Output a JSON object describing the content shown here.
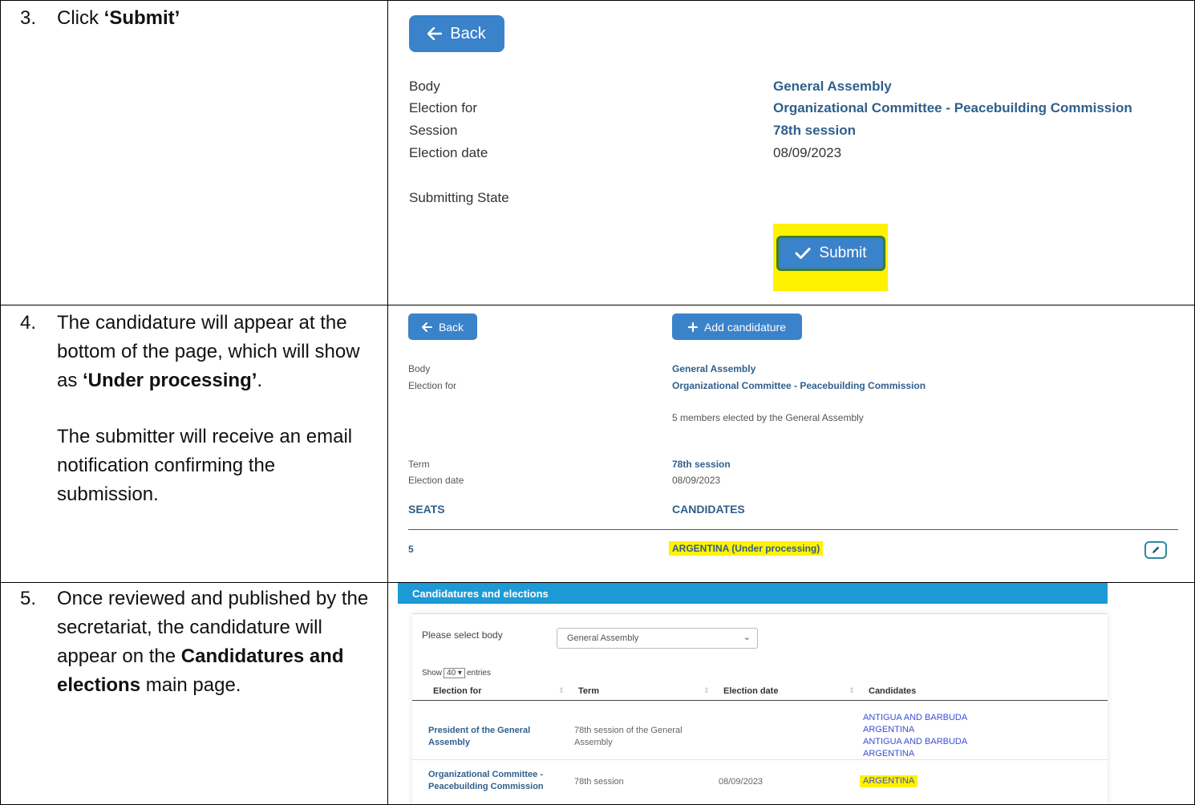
{
  "steps": [
    {
      "number": "3.",
      "lines": [
        {
          "pre": "Click ",
          "bold": "‘Submit’",
          "post": ""
        }
      ]
    },
    {
      "number": "4.",
      "lines": [
        {
          "pre": "The candidature will appear at the bottom of the page, which will show as ",
          "bold": "‘Under processing’",
          "post": "."
        },
        {
          "pre": "The submitter will receive an email notification confirming the submission.",
          "bold": "",
          "post": ""
        }
      ]
    },
    {
      "number": "5.",
      "lines": [
        {
          "pre": "Once reviewed and published by the secretariat, the candidature will appear on the ",
          "bold": "Candidatures and elections",
          "post": " main page."
        }
      ]
    }
  ],
  "shot1": {
    "back_label": "Back",
    "labels": [
      "Body",
      "Election for",
      "Session",
      "Election date",
      "Submitting State"
    ],
    "values": [
      "General Assembly",
      "Organizational Committee - Peacebuilding Commission",
      "78th session",
      "08/09/2023"
    ],
    "submit_label": "Submit"
  },
  "shot2": {
    "back_label": "Back",
    "add_label": "Add candidature",
    "body_label": "Body",
    "body_value": "General Assembly",
    "election_label": "Election for",
    "election_value": "Organizational Committee - Peacebuilding Commission",
    "members_note": "5 members elected by the General Assembly",
    "term_label": "Term",
    "term_value": "78th session",
    "date_label": "Election date",
    "date_value": "08/09/2023",
    "seats_header": "SEATS",
    "candidates_header": "CANDIDATES",
    "seats_value": "5",
    "candidate_value": "ARGENTINA (Under processing)"
  },
  "shot3": {
    "title": "Candidatures and elections",
    "select_body_label": "Please select body",
    "select_value": "General Assembly",
    "show_label": "Show",
    "entries_value": "40",
    "entries_label": "entries",
    "columns": [
      "Election for",
      "Term",
      "Election date",
      "Candidates"
    ],
    "rows": [
      {
        "election_for": [
          "President of the General",
          "Assembly"
        ],
        "term": [
          "78th session of the General",
          "Assembly"
        ],
        "date": "",
        "candidates": [
          "ANTIGUA AND BARBUDA",
          "ARGENTINA",
          "ANTIGUA AND BARBUDA",
          "ARGENTINA"
        ]
      },
      {
        "election_for": [
          "Organizational Committee -",
          "Peacebuilding Commission"
        ],
        "term": [
          "78th session"
        ],
        "date": "08/09/2023",
        "candidates": [
          "ARGENTINA"
        ]
      }
    ]
  },
  "colors": {
    "button_blue": "#3a82c9",
    "highlight": "#fff200",
    "header_blue": "#1d9ad6",
    "value_navy": "#2f5f8c",
    "link_blue": "#3b4fd6"
  }
}
